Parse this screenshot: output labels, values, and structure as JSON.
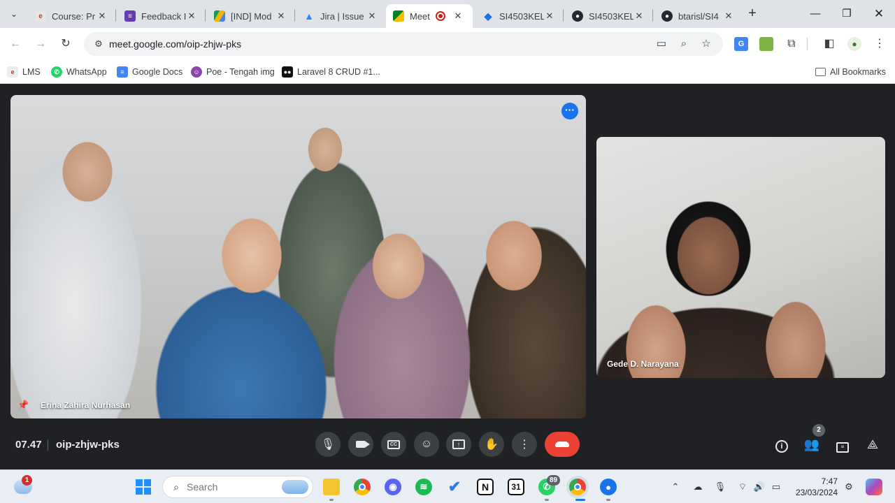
{
  "browser": {
    "tabs": [
      {
        "title": "Course: Pr",
        "favicon": "lms-icon"
      },
      {
        "title": "Feedback I",
        "favicon": "forms-icon"
      },
      {
        "title": "[IND] Mod",
        "favicon": "drive-icon"
      },
      {
        "title": "Jira | Issue",
        "favicon": "jira-icon"
      },
      {
        "title": "Meet",
        "favicon": "meet-icon",
        "active": true,
        "recording": true
      },
      {
        "title": "SI4503KEL",
        "favicon": "diamond-icon"
      },
      {
        "title": "SI4503KEL",
        "favicon": "github-icon"
      },
      {
        "title": "btarisl/SI4",
        "favicon": "github-icon"
      }
    ],
    "url": "meet.google.com/oip-zhjw-pks",
    "bookmarks": [
      {
        "label": "LMS"
      },
      {
        "label": "WhatsApp"
      },
      {
        "label": "Google Docs"
      },
      {
        "label": "Poe - Tengah img"
      },
      {
        "label": "Laravel 8 CRUD #1..."
      }
    ],
    "all_bookmarks_label": "All Bookmarks"
  },
  "meet": {
    "main_participant": "Erina Zahira Nurhasan",
    "side_participant": "Gede D. Narayana",
    "time": "07.47",
    "meeting_code": "oip-zhjw-pks",
    "people_count": "2",
    "colors": {
      "end_call": "#ea4335",
      "accent": "#1a73e8",
      "background": "#202124"
    }
  },
  "taskbar": {
    "weather_badge": "1",
    "search_placeholder": "Search",
    "whatsapp_badge": "89",
    "calendar_day": "31",
    "clock_time": "7:47",
    "clock_date": "23/03/2024"
  }
}
